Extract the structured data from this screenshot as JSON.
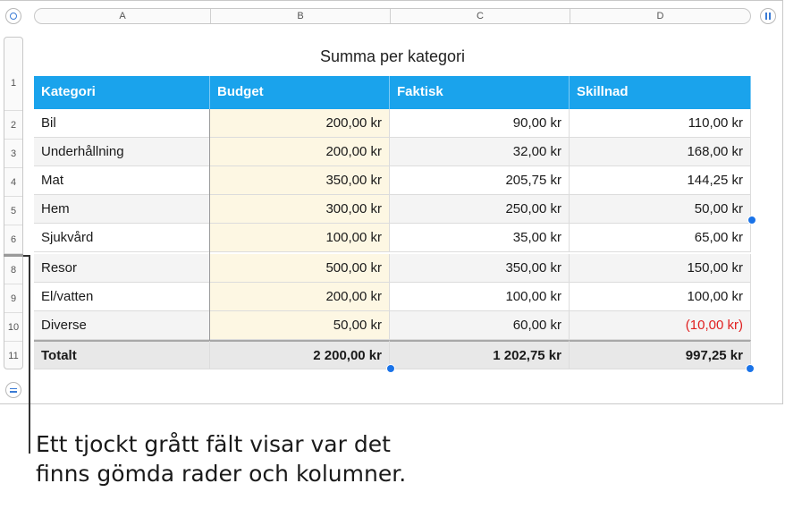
{
  "columns": [
    "A",
    "B",
    "C",
    "D"
  ],
  "rows": [
    "1",
    "2",
    "3",
    "4",
    "5",
    "6",
    "8",
    "9",
    "10",
    "11"
  ],
  "title": "Summa per kategori",
  "table": {
    "headers": [
      "Kategori",
      "Budget",
      "Faktisk",
      "Skillnad"
    ],
    "data": [
      [
        "Bil",
        "200,00 kr",
        "90,00 kr",
        "110,00 kr"
      ],
      [
        "Underhållning",
        "200,00 kr",
        "32,00 kr",
        "168,00 kr"
      ],
      [
        "Mat",
        "350,00 kr",
        "205,75 kr",
        "144,25 kr"
      ],
      [
        "Hem",
        "300,00 kr",
        "250,00 kr",
        "50,00 kr"
      ],
      [
        "Sjukvård",
        "100,00 kr",
        "35,00 kr",
        "65,00 kr"
      ],
      [
        "Resor",
        "500,00 kr",
        "350,00 kr",
        "150,00 kr"
      ],
      [
        "El/vatten",
        "200,00 kr",
        "100,00 kr",
        "100,00 kr"
      ],
      [
        "Diverse",
        "50,00 kr",
        "60,00 kr",
        "(10,00 kr)"
      ]
    ],
    "total": [
      "Totalt",
      "2 200,00 kr",
      "1 202,75 kr",
      "997,25 kr"
    ]
  },
  "callout": "Ett tjockt grått fält visar var det finns gömda rader och kolumner.",
  "colors": {
    "header": "#1aa3ec",
    "negative": "#e02020",
    "budget_fill": "#fdf7e3"
  },
  "icons": {
    "top_left": "table-select-icon",
    "top_right": "column-handle-icon",
    "bottom_left": "row-handle-icon"
  }
}
